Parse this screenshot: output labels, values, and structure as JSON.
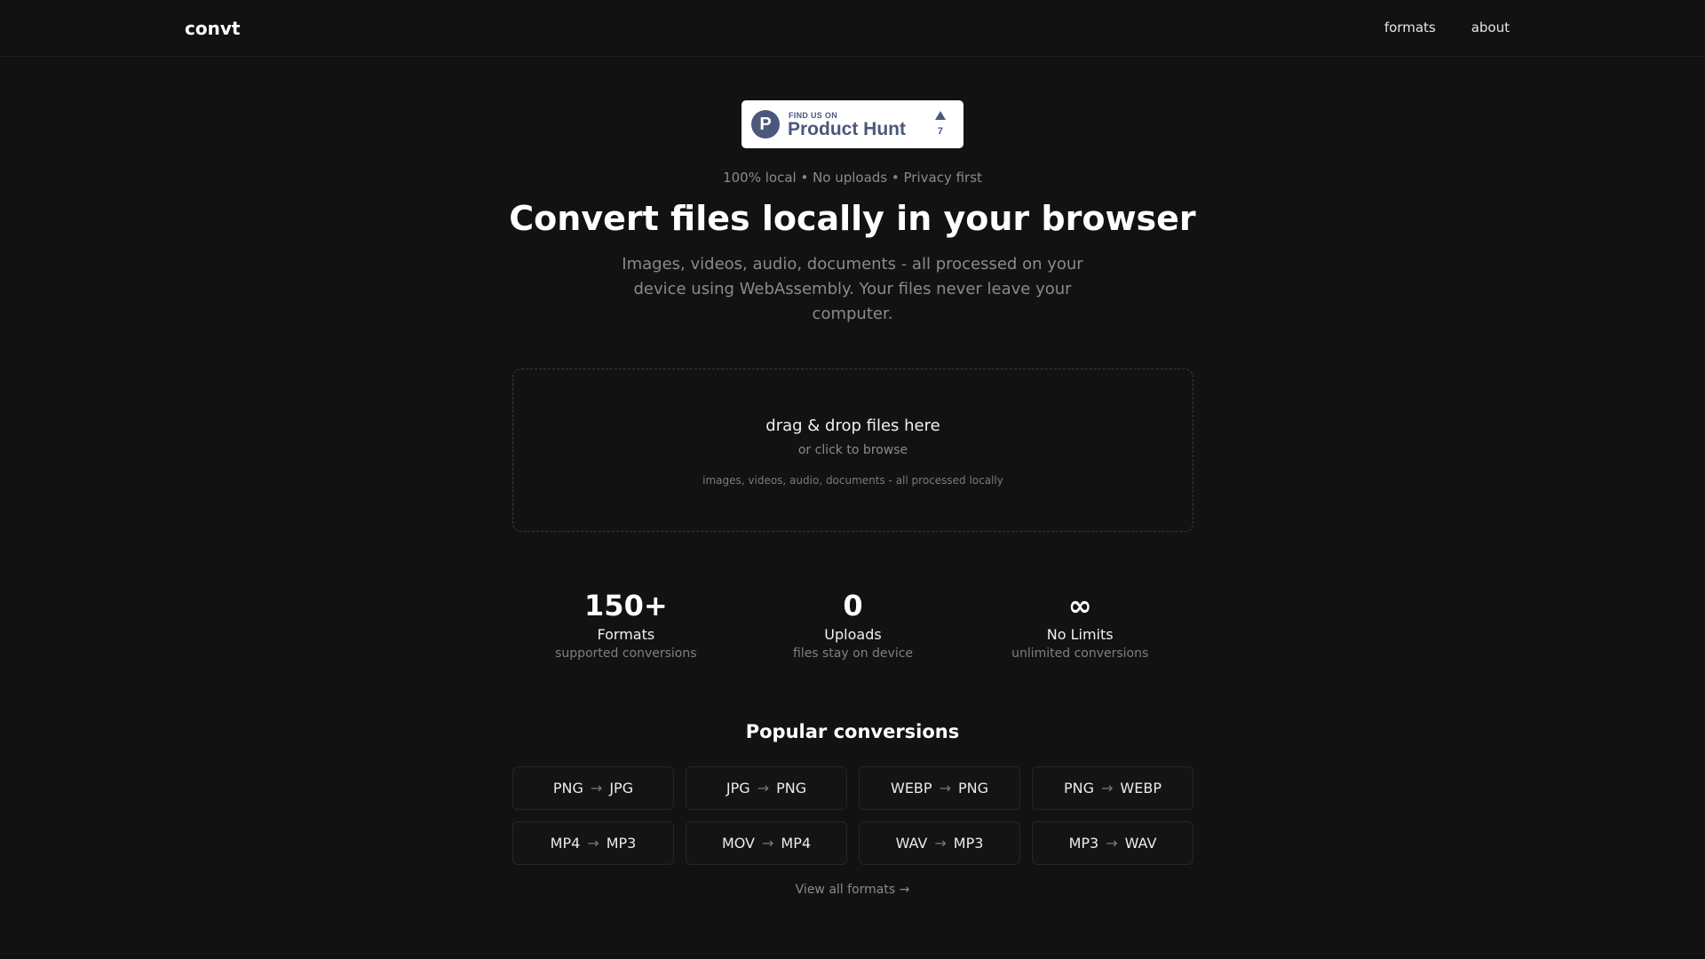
{
  "header": {
    "logo": "convt",
    "nav": [
      {
        "label": "formats"
      },
      {
        "label": "about"
      }
    ]
  },
  "badge": {
    "small_text": "FIND US ON",
    "name": "Product Hunt",
    "logo_letter": "P",
    "upvotes": "7",
    "color": "#4b587c"
  },
  "hero": {
    "tagline": "100% local • No uploads • Privacy first",
    "title": "Convert files locally in your browser",
    "subtitle": "Images, videos, audio, documents - all processed on your device using WebAssembly. Your files never leave your computer."
  },
  "dropzone": {
    "title": "drag & drop files here",
    "browse": "or click to browse",
    "note": "images, videos, audio, documents - all processed locally"
  },
  "stats": [
    {
      "value": "150+",
      "label": "Formats",
      "desc": "supported conversions"
    },
    {
      "value": "0",
      "label": "Uploads",
      "desc": "files stay on device"
    },
    {
      "value": "∞",
      "label": "No Limits",
      "desc": "unlimited conversions"
    }
  ],
  "popular": {
    "title": "Popular conversions",
    "arrow": "→",
    "items": [
      {
        "from": "PNG",
        "to": "JPG"
      },
      {
        "from": "JPG",
        "to": "PNG"
      },
      {
        "from": "WEBP",
        "to": "PNG"
      },
      {
        "from": "PNG",
        "to": "WEBP"
      },
      {
        "from": "MP4",
        "to": "MP3"
      },
      {
        "from": "MOV",
        "to": "MP4"
      },
      {
        "from": "WAV",
        "to": "MP3"
      },
      {
        "from": "MP3",
        "to": "WAV"
      }
    ],
    "view_all": "View all formats →"
  },
  "colors": {
    "background": "#121212",
    "text": "#ffffff",
    "muted": "#8a8a8a",
    "border": "#262626"
  }
}
